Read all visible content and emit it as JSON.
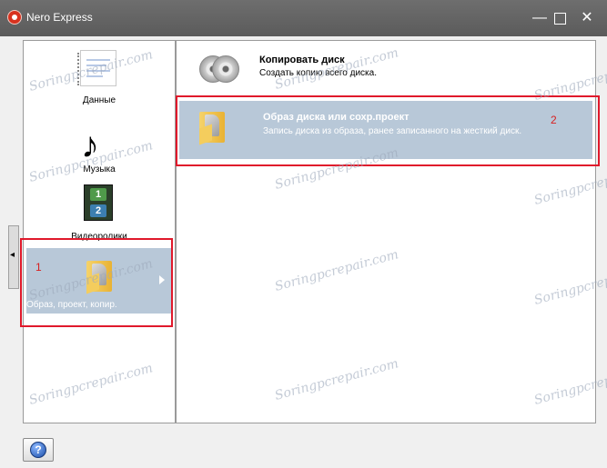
{
  "window": {
    "title": "Nero Express",
    "minimize_glyph": "—",
    "close_glyph": "✕"
  },
  "sidebar": {
    "items": [
      {
        "label": "Данные",
        "icon": "document-icon",
        "selected": false
      },
      {
        "label": "Музыка",
        "icon": "music-note-icon",
        "selected": false
      },
      {
        "label": "Видеоролики",
        "icon": "film-icon",
        "selected": false
      },
      {
        "label": "Образ, проект, копир.",
        "icon": "folder-image-icon",
        "selected": true
      }
    ],
    "collapse_glyph": "◂",
    "frame_numbers": [
      "1",
      "2"
    ]
  },
  "options": [
    {
      "title": "Копировать диск",
      "description": "Создать копию всего диска.",
      "icon": "discs-icon",
      "selected": false
    },
    {
      "title": "Образ диска или сохр.проект",
      "description": "Запись диска из образа, ранее записанного на жесткий диск.",
      "icon": "folder-image-icon",
      "selected": true
    }
  ],
  "annotations": {
    "left_number": "1",
    "right_number": "2",
    "color": "#e0192b"
  },
  "help": {
    "label": "?"
  },
  "watermark": {
    "text": "Soringpcrepair.com"
  },
  "colors": {
    "selection": "#b8c8d8",
    "titlebar": "#5b5b5b",
    "annotation": "#e0192b"
  }
}
